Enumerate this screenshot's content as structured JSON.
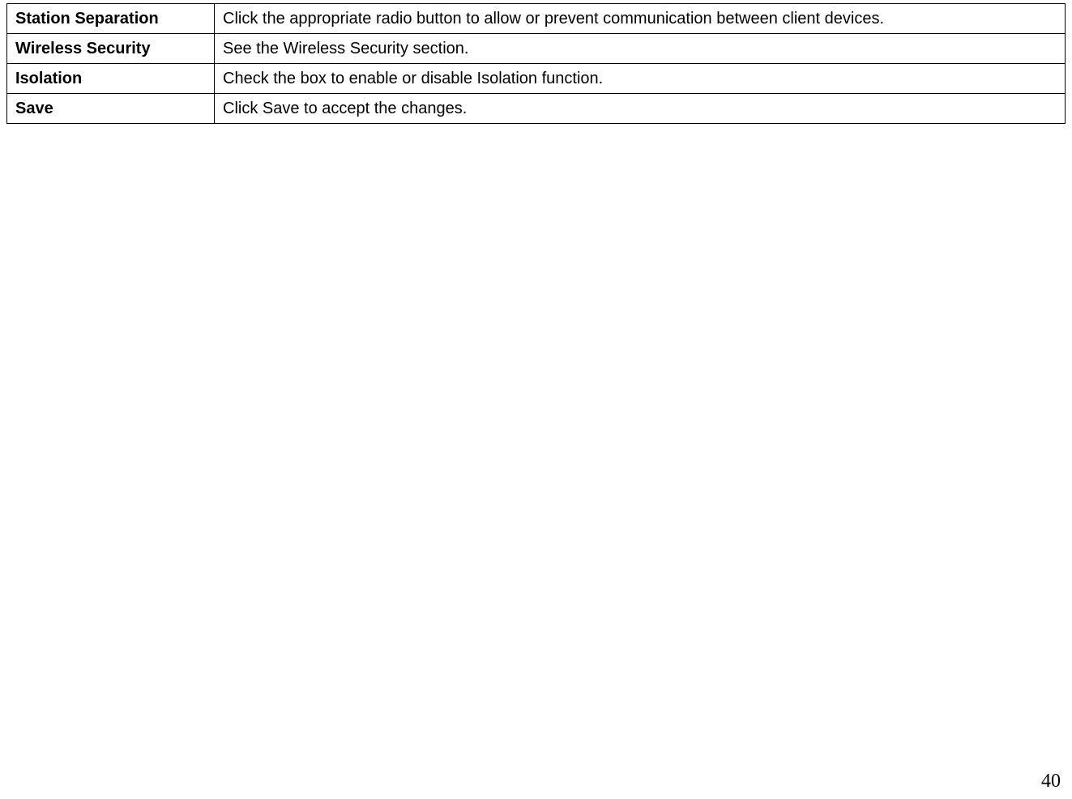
{
  "table": {
    "rows": [
      {
        "label": "Station Separation",
        "description": "Click the appropriate radio button to allow or prevent communication between client devices."
      },
      {
        "label": "Wireless Security",
        "description": "See the Wireless Security section."
      },
      {
        "label": "Isolation",
        "description": "Check the box to enable or disable Isolation function."
      },
      {
        "label": "Save",
        "description": "Click Save to accept the changes."
      }
    ]
  },
  "page_number": "40"
}
